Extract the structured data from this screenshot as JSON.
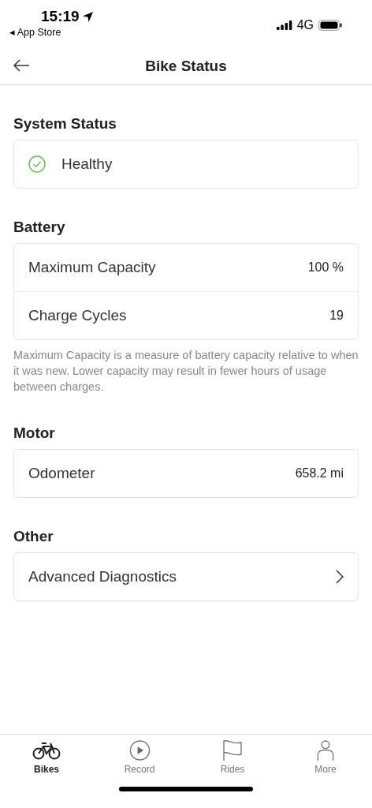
{
  "status_bar": {
    "time": "15:19",
    "back_app": "◂ App Store",
    "network": "4G"
  },
  "header": {
    "title": "Bike Status"
  },
  "sections": [
    {
      "title": "System Status",
      "rows": [
        {
          "kind": "status",
          "label": "Healthy"
        }
      ]
    },
    {
      "title": "Battery",
      "rows": [
        {
          "kind": "value",
          "label": "Maximum Capacity",
          "value": "100 %"
        },
        {
          "kind": "value",
          "label": "Charge Cycles",
          "value": "19"
        }
      ],
      "note": "Maximum Capacity is a measure of battery capacity relative to when it was new. Lower capacity may result in fewer hours of usage between charges."
    },
    {
      "title": "Motor",
      "rows": [
        {
          "kind": "value",
          "label": "Odometer",
          "value": "658.2 mi"
        }
      ]
    },
    {
      "title": "Other",
      "rows": [
        {
          "kind": "link",
          "label": "Advanced Diagnostics"
        }
      ]
    }
  ],
  "tabs": [
    {
      "kind": "bike",
      "label": "Bikes",
      "selected": true
    },
    {
      "kind": "record",
      "label": "Record",
      "selected": false
    },
    {
      "kind": "flag",
      "label": "Rides",
      "selected": false
    },
    {
      "kind": "person",
      "label": "More",
      "selected": false
    }
  ]
}
